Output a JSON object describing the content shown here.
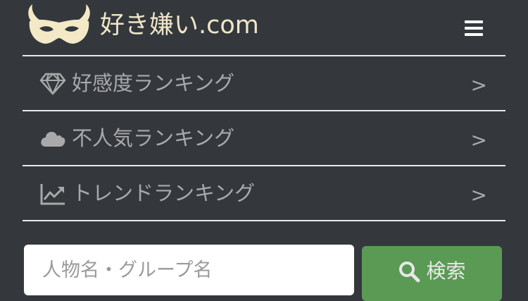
{
  "header": {
    "site_title": "好き嫌い.com",
    "logo_icon": "mask-logo-icon",
    "menu_icon": "hamburger-menu-icon",
    "title_color": "#efe6c8"
  },
  "nav": {
    "items": [
      {
        "icon": "diamond-icon",
        "label": "好感度ランキング",
        "arrow": ">"
      },
      {
        "icon": "cloud-icon",
        "label": "不人気ランキング",
        "arrow": ">"
      },
      {
        "icon": "trend-chart-icon",
        "label": "トレンドランキング",
        "arrow": ">"
      }
    ]
  },
  "search": {
    "placeholder": "人物名・グループ名",
    "value": "",
    "button_label": "検索",
    "button_icon": "search-icon",
    "button_color": "#5a9a55"
  }
}
